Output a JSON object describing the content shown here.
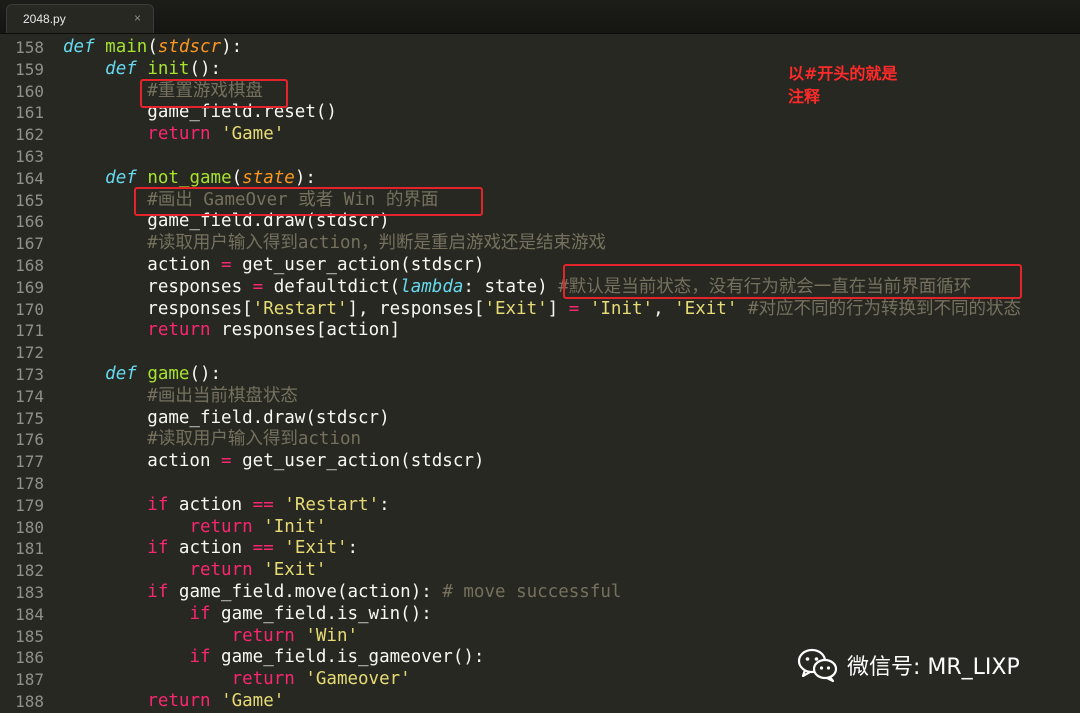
{
  "tab": {
    "title": "2048.py",
    "close": "×"
  },
  "annotation": {
    "line1": "以#开头的就是",
    "line2": "注释"
  },
  "watermark": {
    "text": "微信号: MR_LIXP",
    "icon": "wechat-icon"
  },
  "lines": [
    {
      "n": "158",
      "t": [
        [
          "kw",
          "def "
        ],
        [
          "fn",
          "main"
        ],
        [
          "p",
          "("
        ],
        [
          "param",
          "stdscr"
        ],
        [
          "p",
          "):"
        ]
      ]
    },
    {
      "n": "159",
      "t": [
        [
          "p",
          "    "
        ],
        [
          "kw",
          "def "
        ],
        [
          "fn",
          "init"
        ],
        [
          "p",
          "():"
        ]
      ]
    },
    {
      "n": "160",
      "t": [
        [
          "p",
          "        "
        ],
        [
          "cm",
          "#重置游戏棋盘"
        ]
      ]
    },
    {
      "n": "161",
      "t": [
        [
          "p",
          "        game_field.reset()"
        ]
      ]
    },
    {
      "n": "162",
      "t": [
        [
          "p",
          "        "
        ],
        [
          "op",
          "return "
        ],
        [
          "str",
          "'Game'"
        ]
      ]
    },
    {
      "n": "163",
      "t": []
    },
    {
      "n": "164",
      "t": [
        [
          "p",
          "    "
        ],
        [
          "kw",
          "def "
        ],
        [
          "fn",
          "not_game"
        ],
        [
          "p",
          "("
        ],
        [
          "param",
          "state"
        ],
        [
          "p",
          "):"
        ]
      ]
    },
    {
      "n": "165",
      "t": [
        [
          "p",
          "        "
        ],
        [
          "cm",
          "#画出 GameOver 或者 Win 的界面"
        ]
      ]
    },
    {
      "n": "166",
      "t": [
        [
          "p",
          "        game_field.draw(stdscr)"
        ]
      ]
    },
    {
      "n": "167",
      "t": [
        [
          "p",
          "        "
        ],
        [
          "cm",
          "#读取用户输入得到action，判断是重启游戏还是结束游戏"
        ]
      ]
    },
    {
      "n": "168",
      "t": [
        [
          "p",
          "        action "
        ],
        [
          "op",
          "="
        ],
        [
          "p",
          " get_user_action(stdscr)"
        ]
      ]
    },
    {
      "n": "169",
      "t": [
        [
          "p",
          "        responses "
        ],
        [
          "op",
          "="
        ],
        [
          "p",
          " defaultdict("
        ],
        [
          "kw",
          "lambda"
        ],
        [
          "p",
          ": state) "
        ],
        [
          "cm",
          "#默认是当前状态，没有行为就会一直在当前界面循环"
        ]
      ]
    },
    {
      "n": "170",
      "t": [
        [
          "p",
          "        responses["
        ],
        [
          "str",
          "'Restart'"
        ],
        [
          "p",
          "], responses["
        ],
        [
          "str",
          "'Exit'"
        ],
        [
          "p",
          "] "
        ],
        [
          "op",
          "="
        ],
        [
          "p",
          " "
        ],
        [
          "str",
          "'Init'"
        ],
        [
          "p",
          ", "
        ],
        [
          "str",
          "'Exit'"
        ],
        [
          "p",
          " "
        ],
        [
          "cm",
          "#对应不同的行为转换到不同的状态"
        ]
      ]
    },
    {
      "n": "171",
      "t": [
        [
          "p",
          "        "
        ],
        [
          "op",
          "return "
        ],
        [
          "p",
          "responses[action]"
        ]
      ]
    },
    {
      "n": "172",
      "t": []
    },
    {
      "n": "173",
      "t": [
        [
          "p",
          "    "
        ],
        [
          "kw",
          "def "
        ],
        [
          "fn",
          "game"
        ],
        [
          "p",
          "():"
        ]
      ]
    },
    {
      "n": "174",
      "t": [
        [
          "p",
          "        "
        ],
        [
          "cm",
          "#画出当前棋盘状态"
        ]
      ]
    },
    {
      "n": "175",
      "t": [
        [
          "p",
          "        game_field.draw(stdscr)"
        ]
      ]
    },
    {
      "n": "176",
      "t": [
        [
          "p",
          "        "
        ],
        [
          "cm",
          "#读取用户输入得到action"
        ]
      ]
    },
    {
      "n": "177",
      "t": [
        [
          "p",
          "        action "
        ],
        [
          "op",
          "="
        ],
        [
          "p",
          " get_user_action(stdscr)"
        ]
      ]
    },
    {
      "n": "178",
      "t": []
    },
    {
      "n": "179",
      "t": [
        [
          "p",
          "        "
        ],
        [
          "op",
          "if "
        ],
        [
          "p",
          "action "
        ],
        [
          "op",
          "=="
        ],
        [
          "p",
          " "
        ],
        [
          "str",
          "'Restart'"
        ],
        [
          "p",
          ":"
        ]
      ]
    },
    {
      "n": "180",
      "t": [
        [
          "p",
          "            "
        ],
        [
          "op",
          "return "
        ],
        [
          "str",
          "'Init'"
        ]
      ]
    },
    {
      "n": "181",
      "t": [
        [
          "p",
          "        "
        ],
        [
          "op",
          "if "
        ],
        [
          "p",
          "action "
        ],
        [
          "op",
          "=="
        ],
        [
          "p",
          " "
        ],
        [
          "str",
          "'Exit'"
        ],
        [
          "p",
          ":"
        ]
      ]
    },
    {
      "n": "182",
      "t": [
        [
          "p",
          "            "
        ],
        [
          "op",
          "return "
        ],
        [
          "str",
          "'Exit'"
        ]
      ]
    },
    {
      "n": "183",
      "t": [
        [
          "p",
          "        "
        ],
        [
          "op",
          "if "
        ],
        [
          "p",
          "game_field.move(action): "
        ],
        [
          "cm",
          "# move successful"
        ]
      ]
    },
    {
      "n": "184",
      "t": [
        [
          "p",
          "            "
        ],
        [
          "op",
          "if "
        ],
        [
          "p",
          "game_field.is_win():"
        ]
      ]
    },
    {
      "n": "185",
      "t": [
        [
          "p",
          "                "
        ],
        [
          "op",
          "return "
        ],
        [
          "str",
          "'Win'"
        ]
      ]
    },
    {
      "n": "186",
      "t": [
        [
          "p",
          "            "
        ],
        [
          "op",
          "if "
        ],
        [
          "p",
          "game_field.is_gameover():"
        ]
      ]
    },
    {
      "n": "187",
      "t": [
        [
          "p",
          "                "
        ],
        [
          "op",
          "return "
        ],
        [
          "str",
          "'Gameover'"
        ]
      ]
    },
    {
      "n": "188",
      "t": [
        [
          "p",
          "        "
        ],
        [
          "op",
          "return "
        ],
        [
          "str",
          "'Game'"
        ]
      ]
    }
  ]
}
